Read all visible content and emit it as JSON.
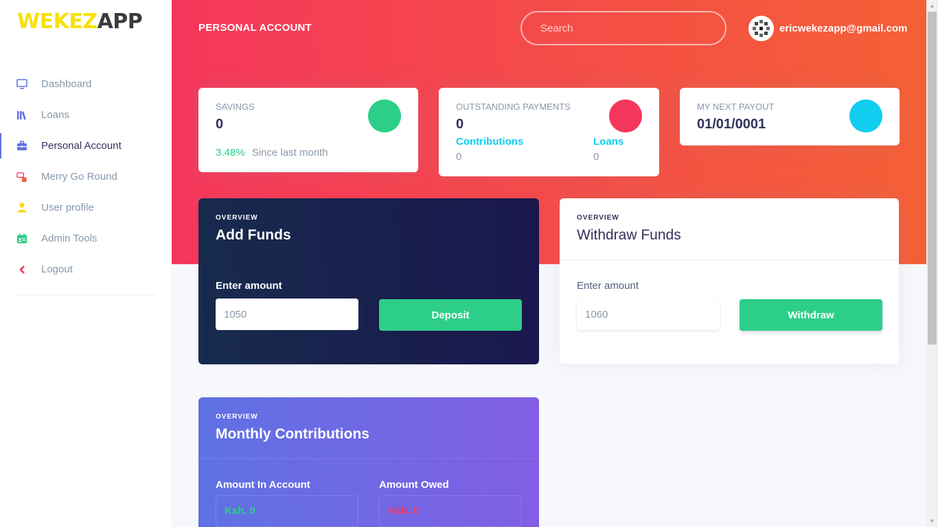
{
  "brand": {
    "part1": "WEKEZ",
    "part2": "APP"
  },
  "sidebar": {
    "items": [
      {
        "label": "Dashboard",
        "icon": "tv-icon"
      },
      {
        "label": "Loans",
        "icon": "books-icon"
      },
      {
        "label": "Personal Account",
        "icon": "briefcase-icon",
        "active": true
      },
      {
        "label": "Merry Go Round",
        "icon": "coins-icon"
      },
      {
        "label": "User profile",
        "icon": "user-icon"
      },
      {
        "label": "Admin Tools",
        "icon": "badge-icon"
      },
      {
        "label": "Logout",
        "icon": "chevron-left-icon"
      }
    ]
  },
  "header": {
    "title": "PERSONAL ACCOUNT",
    "search_placeholder": "Search",
    "user_email": "ericwekezapp@gmail.com"
  },
  "stats": {
    "savings": {
      "title": "SAVINGS",
      "value": "0",
      "change": "3.48%",
      "change_label": "Since last month",
      "color": "#2dce89"
    },
    "outstanding": {
      "title": "OUTSTANDING PAYMENTS",
      "value": "0",
      "contributions_label": "Contributions",
      "contributions_value": "0",
      "loans_label": "Loans",
      "loans_value": "0",
      "color": "#f5365c"
    },
    "payout": {
      "title": "MY NEXT PAYOUT",
      "value": "01/01/0001",
      "color": "#11cdef"
    }
  },
  "add_funds": {
    "overline": "OVERVIEW",
    "title": "Add Funds",
    "field_label": "Enter amount",
    "amount": "1050",
    "button": "Deposit"
  },
  "withdraw_funds": {
    "overline": "OVERVIEW",
    "title": "Withdraw Funds",
    "field_label": "Enter amount",
    "amount": "1060",
    "button": "Withdraw"
  },
  "monthly": {
    "overline": "OVERVIEW",
    "title": "Monthly Contributions",
    "in_account_label": "Amount In Account",
    "in_account_value": "Ksh. 0",
    "owed_label": "Amount Owed",
    "owed_value": "Ksh. 0"
  },
  "colors": {
    "accent_red": "#f5365c",
    "accent_orange": "#f56036",
    "green": "#2dce89",
    "cyan": "#11cdef",
    "navy": "#172b4d",
    "purple": "#825ee4"
  }
}
